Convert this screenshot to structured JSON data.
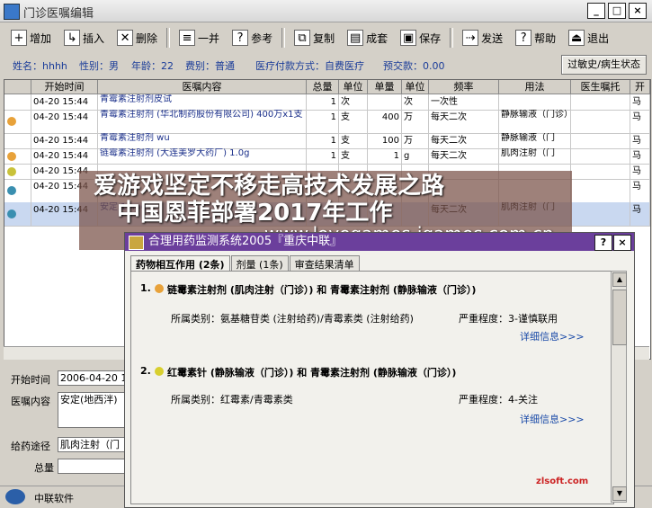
{
  "window": {
    "title": "门诊医嘱编辑",
    "controls": [
      "_",
      "□",
      "×"
    ]
  },
  "toolbar": [
    {
      "label": "增加",
      "icon": "add-doc-icon"
    },
    {
      "label": "插入",
      "icon": "insert-doc-icon"
    },
    {
      "label": "删除",
      "icon": "delete-icon"
    },
    {
      "label": "一并",
      "icon": "merge-icon"
    },
    {
      "label": "参考",
      "icon": "reference-icon"
    },
    {
      "label": "复制",
      "icon": "copy-icon"
    },
    {
      "label": "成套",
      "icon": "set-icon"
    },
    {
      "label": "保存",
      "icon": "save-icon"
    },
    {
      "label": "发送",
      "icon": "send-icon"
    },
    {
      "label": "帮助",
      "icon": "help-icon"
    },
    {
      "label": "退出",
      "icon": "exit-icon"
    }
  ],
  "patient": {
    "name": "姓名：hhhh",
    "gender": "性别：男",
    "age": "年龄：22",
    "fee_type": "费别：普通",
    "payment": "医疗付款方式：自费医疗",
    "deposit": "预交款：0.00",
    "allergy_button": "过敏史/病生状态"
  },
  "grid": {
    "columns": [
      "开始时间",
      "医嘱内容",
      "总量",
      "单位",
      "单量",
      "单位",
      "频率",
      "用法",
      "医生嘱托",
      "开"
    ],
    "rows": [
      {
        "dot": "",
        "time": "04-20 15:44",
        "content": "青霉素注射剂皮试",
        "total": "1",
        "unit": "次",
        "dose": "",
        "dunit": "次",
        "freq": "一次性",
        "usage": "",
        "note": "",
        "extra": "马"
      },
      {
        "dot": "#e8a23a",
        "time": "04-20 15:44",
        "content": "青霉素注射剂 (华北制药股份有限公司) 400万x1支",
        "total": "1",
        "unit": "支",
        "dose": "400",
        "dunit": "万",
        "freq": "每天二次",
        "usage": "静脉输液（门诊）",
        "note": "",
        "extra": "马"
      },
      {
        "dot": "",
        "time": "04-20 15:44",
        "content": "青霉素注射剂 wu",
        "total": "1",
        "unit": "支",
        "dose": "100",
        "dunit": "万",
        "freq": "每天二次",
        "usage": "静脉输液（门",
        "note": "",
        "extra": "马"
      },
      {
        "dot": "#e8a23a",
        "time": "04-20 15:44",
        "content": "链霉素注射剂 (大连美罗大药厂) 1.0g",
        "total": "1",
        "unit": "支",
        "dose": "1",
        "dunit": "g",
        "freq": "每天二次",
        "usage": "肌肉注射（门",
        "note": "",
        "extra": "马"
      },
      {
        "dot": "#c9c23a",
        "time": "04-20 15:44",
        "content": "",
        "total": "",
        "unit": "",
        "dose": "",
        "dunit": "",
        "freq": "",
        "usage": "",
        "note": "",
        "extra": "马"
      },
      {
        "dot": "#3a8fb0",
        "time": "04-20 15:44",
        "content": "",
        "total": "",
        "unit": "",
        "dose": "",
        "dunit": "",
        "freq": "",
        "usage": "",
        "note": "",
        "extra": "马"
      },
      {
        "dot": "#3a8fb0",
        "time": "04-20 15:44",
        "content": "安定 10mg",
        "total": "",
        "unit": "",
        "dose": "",
        "dunit": "",
        "freq": "每天二次",
        "usage": "肌肉注射（门",
        "note": "",
        "extra": "马"
      }
    ]
  },
  "detail": {
    "start_label": "开始时间",
    "start_value": "2006-04-20 1",
    "content_label": "医嘱内容",
    "content_value": "安定(地西泮)",
    "route_label": "给药途径",
    "route_value": "肌肉注射（门",
    "total_label": "总量",
    "total_value": ""
  },
  "status": {
    "company": "中联软件"
  },
  "dialog": {
    "title": "合理用药监测系统2005『重庆中联』",
    "tabs": [
      "药物相互作用 (2条)",
      "剂量 (1条)",
      "审查结果清单"
    ],
    "items": [
      {
        "index": "1.",
        "dot": "#e8a23a",
        "title": "链霉素注射剂 (肌肉注射（门诊）) 和 青霉素注射剂 (静脉输液（门诊）)",
        "category": "所属类别：氨基糖苷类 (注射给药)/青霉素类 (注射给药)",
        "severity": "严重程度：3-谨慎联用",
        "link": "详细信息>>>"
      },
      {
        "index": "2.",
        "dot": "#d8cf2f",
        "title": "红霉素针 (静脉输液（门诊）) 和 青霉素注射剂 (静脉输液（门诊）)",
        "category": "所属类别：红霉素/青霉素类",
        "severity": "严重程度：4-关注",
        "link": "详细信息>>>"
      }
    ]
  },
  "watermark": {
    "line1": "爱游戏坚定不移走高技术发展之路",
    "line2": "中国恩菲部署2017年工作",
    "line3": "www.lovegames-igames.com.cn",
    "footer": "zlsoft.com"
  }
}
